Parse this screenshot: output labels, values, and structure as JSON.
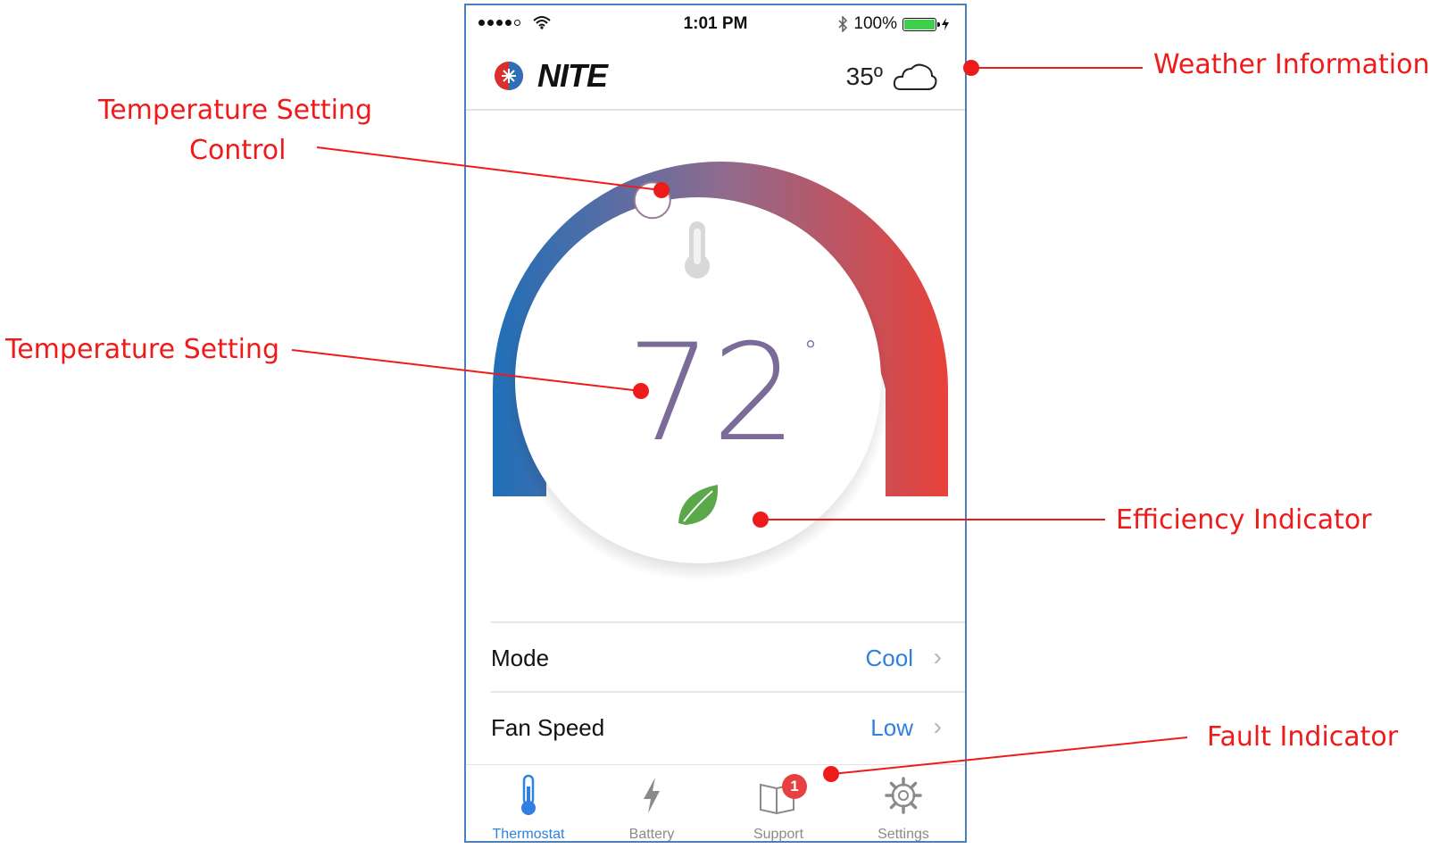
{
  "status_bar": {
    "time": "1:01 PM",
    "battery_percent": "100%",
    "signal_bars": 4,
    "battery_level": 1.0
  },
  "header": {
    "brand": "NITE",
    "weather_temp": "35º",
    "weather_icon": "cloud-icon"
  },
  "thermostat": {
    "setpoint": "72",
    "degree_symbol": "°",
    "efficiency_icon": "leaf-icon",
    "setpoint_position": 0.39
  },
  "settings": [
    {
      "label": "Mode",
      "value": "Cool"
    },
    {
      "label": "Fan Speed",
      "value": "Low"
    }
  ],
  "tabs": [
    {
      "label": "Thermostat",
      "icon": "thermometer-icon",
      "active": true
    },
    {
      "label": "Battery",
      "icon": "bolt-icon"
    },
    {
      "label": "Support",
      "icon": "book-icon",
      "badge": "1"
    },
    {
      "label": "Settings",
      "icon": "gear-icon"
    }
  ],
  "callouts": {
    "weather": "Weather Information",
    "temp_control_line1": "Temperature Setting",
    "temp_control_line2": "Control",
    "temp_setting": "Temperature Setting",
    "efficiency": "Efficiency Indicator",
    "fault": "Fault Indicator"
  },
  "colors": {
    "accent": "#2f80e0",
    "annotation": "#ee1b1b",
    "dial_cold": "#1f6fb8",
    "dial_hot": "#e8413a",
    "leaf": "#5aa84a",
    "frame": "#4a7fc0"
  }
}
